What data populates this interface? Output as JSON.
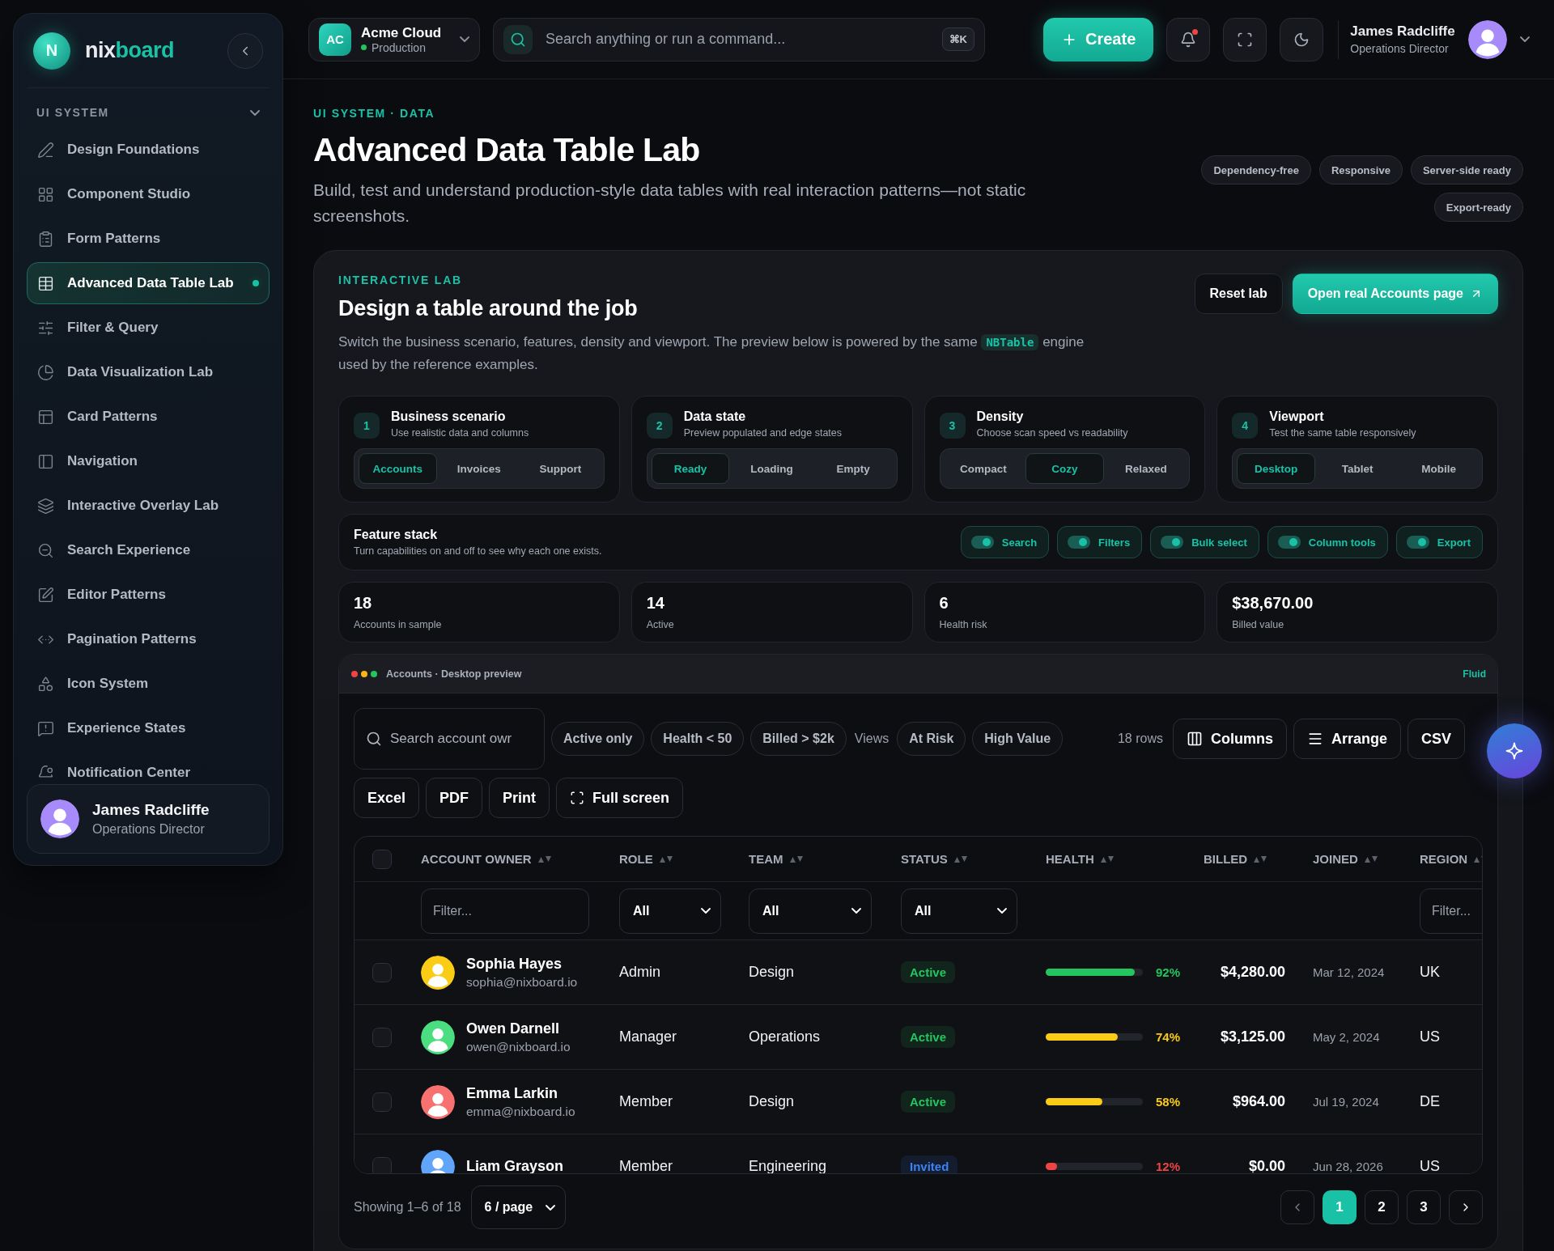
{
  "sidebar": {
    "brand": {
      "initial": "N",
      "name_first": "nix",
      "name_second": "board"
    },
    "section": {
      "label": "UI SYSTEM",
      "expanded": true
    },
    "items": [
      {
        "label": "Design Foundations",
        "selected": false
      },
      {
        "label": "Component Studio",
        "selected": false
      },
      {
        "label": "Form Patterns",
        "selected": false
      },
      {
        "label": "Advanced Data Table Lab",
        "selected": true
      },
      {
        "label": "Filter & Query",
        "selected": false
      },
      {
        "label": "Data Visualization Lab",
        "selected": false
      },
      {
        "label": "Card Patterns",
        "selected": false
      },
      {
        "label": "Navigation",
        "selected": false
      },
      {
        "label": "Interactive Overlay Lab",
        "selected": false
      },
      {
        "label": "Search Experience",
        "selected": false
      },
      {
        "label": "Editor Patterns",
        "selected": false
      },
      {
        "label": "Pagination Patterns",
        "selected": false
      },
      {
        "label": "Icon System",
        "selected": false
      },
      {
        "label": "Experience States",
        "selected": false
      },
      {
        "label": "Notification Center",
        "selected": false
      }
    ],
    "user": {
      "name": "James Radcliffe",
      "role": "Operations Director"
    }
  },
  "topbar": {
    "workspace": {
      "initials": "AC",
      "name": "Acme Cloud",
      "env": "Production",
      "online": true
    },
    "search": {
      "placeholder": "Search anything or run a command...",
      "shortcut": "⌘K"
    },
    "create": "Create",
    "notifications": {
      "unread": true
    },
    "user": {
      "name": "James Radcliffe",
      "role": "Operations Director"
    }
  },
  "header": {
    "breadcrumb": "UI SYSTEM · DATA",
    "title": "Advanced Data Table Lab",
    "description": "Build, test and understand production-style data tables with real interaction patterns—not static screenshots.",
    "tags": [
      "Dependency-free",
      "Responsive",
      "Server-side ready",
      "Export-ready"
    ]
  },
  "lab": {
    "eyebrow": "INTERACTIVE LAB",
    "title": "Design a table around the job",
    "description": {
      "before": "Switch the business scenario, features, density and viewport. The preview below is powered by the same",
      "code": "NBTable",
      "after": "engine used by the reference examples."
    },
    "actions": [
      {
        "label": "Reset lab",
        "kind": "secondary"
      },
      {
        "label": "Open real Accounts page",
        "kind": "primary"
      }
    ],
    "controls": [
      {
        "step": "1",
        "title": "Business scenario",
        "subtitle": "Use realistic data and columns",
        "options": [
          {
            "label": "Accounts",
            "selected": true
          },
          {
            "label": "Invoices",
            "selected": false
          },
          {
            "label": "Support",
            "selected": false
          }
        ]
      },
      {
        "step": "2",
        "title": "Data state",
        "subtitle": "Preview populated and edge states",
        "options": [
          {
            "label": "Ready",
            "selected": true
          },
          {
            "label": "Loading",
            "selected": false
          },
          {
            "label": "Empty",
            "selected": false
          }
        ]
      },
      {
        "step": "3",
        "title": "Density",
        "subtitle": "Choose scan speed vs readability",
        "options": [
          {
            "label": "Compact",
            "selected": false
          },
          {
            "label": "Cozy",
            "selected": true
          },
          {
            "label": "Relaxed",
            "selected": false
          }
        ]
      },
      {
        "step": "4",
        "title": "Viewport",
        "subtitle": "Test the same table responsively",
        "options": [
          {
            "label": "Desktop",
            "selected": true
          },
          {
            "label": "Tablet",
            "selected": false
          },
          {
            "label": "Mobile",
            "selected": false
          }
        ]
      }
    ],
    "feature_stack": {
      "title": "Feature stack",
      "subtitle": "Turn capabilities on and off to see why each one exists.",
      "toggles": [
        {
          "label": "Search",
          "on": true
        },
        {
          "label": "Filters",
          "on": true
        },
        {
          "label": "Bulk select",
          "on": true
        },
        {
          "label": "Column tools",
          "on": true
        },
        {
          "label": "Export",
          "on": true
        }
      ]
    },
    "stats": [
      {
        "value": "18",
        "label": "Accounts in sample"
      },
      {
        "value": "14",
        "label": "Active"
      },
      {
        "value": "6",
        "label": "Health risk"
      },
      {
        "value": "$38,670.00",
        "label": "Billed value"
      }
    ]
  },
  "preview": {
    "title": "Accounts · Desktop preview",
    "mode": "Fluid",
    "search": {
      "placeholder": "Search account owr"
    },
    "quick_filters": [
      "Active only",
      "Health < 50",
      "Billed > $2k"
    ],
    "views_label": "Views",
    "views": [
      "At Risk",
      "High Value"
    ],
    "row_count": "18 rows",
    "tools": [
      "Columns",
      "Arrange",
      "CSV"
    ],
    "exports": [
      "Excel",
      "PDF",
      "Print",
      "Full screen"
    ],
    "select_all": {
      "checked": false
    },
    "columns": [
      {
        "label": "ACCOUNT OWNER",
        "filter": {
          "kind": "text",
          "placeholder": "Filter..."
        }
      },
      {
        "label": "ROLE",
        "filter": {
          "kind": "select",
          "value": "All"
        }
      },
      {
        "label": "TEAM",
        "filter": {
          "kind": "select",
          "value": "All"
        }
      },
      {
        "label": "STATUS",
        "filter": {
          "kind": "select",
          "value": "All"
        }
      },
      {
        "label": "HEALTH",
        "filter": {
          "kind": "none"
        }
      },
      {
        "label": "BILLED",
        "filter": {
          "kind": "none"
        }
      },
      {
        "label": "JOINED",
        "filter": {
          "kind": "none"
        }
      },
      {
        "label": "REGION",
        "filter": {
          "kind": "text",
          "placeholder": "Filter..."
        }
      }
    ],
    "rows": [
      {
        "checked": false,
        "avatar": {
          "color": "#facc15"
        },
        "name": "Sophia Hayes",
        "email": "sophia@nixboard.io",
        "role": "Admin",
        "team": "Design",
        "status": {
          "label": "Active",
          "color": "#22c55e"
        },
        "health": {
          "level": 0.92,
          "reading": "92%",
          "color": "#22c55e"
        },
        "billed": "$4,280.00",
        "joined": "Mar 12, 2024",
        "region": "UK"
      },
      {
        "checked": false,
        "avatar": {
          "color": "#4ade80"
        },
        "name": "Owen Darnell",
        "email": "owen@nixboard.io",
        "role": "Manager",
        "team": "Operations",
        "status": {
          "label": "Active",
          "color": "#22c55e"
        },
        "health": {
          "level": 0.74,
          "reading": "74%",
          "color": "#facc15"
        },
        "billed": "$3,125.00",
        "joined": "May 2, 2024",
        "region": "US"
      },
      {
        "checked": false,
        "avatar": {
          "color": "#f87171"
        },
        "name": "Emma Larkin",
        "email": "emma@nixboard.io",
        "role": "Member",
        "team": "Design",
        "status": {
          "label": "Active",
          "color": "#22c55e"
        },
        "health": {
          "level": 0.58,
          "reading": "58%",
          "color": "#facc15"
        },
        "billed": "$964.00",
        "joined": "Jul 19, 2024",
        "region": "DE"
      },
      {
        "checked": false,
        "avatar": {
          "color": "#60a5fa"
        },
        "name": "Liam Grayson",
        "role": "Member",
        "team": "Engineering",
        "status": {
          "label": "Invited",
          "color": "#3b82f6"
        },
        "health": {
          "level": 0.12,
          "reading": "12%",
          "color": "#ef4444"
        },
        "billed": "$0.00",
        "joined": "Jun 28, 2026",
        "region": "US"
      }
    ],
    "footer": {
      "showing": "Showing 1–6 of 18",
      "page_size": "6 / page",
      "pages": [
        {
          "label": "1",
          "selected": true
        },
        {
          "label": "2",
          "selected": false
        },
        {
          "label": "3",
          "selected": false
        }
      ]
    }
  }
}
